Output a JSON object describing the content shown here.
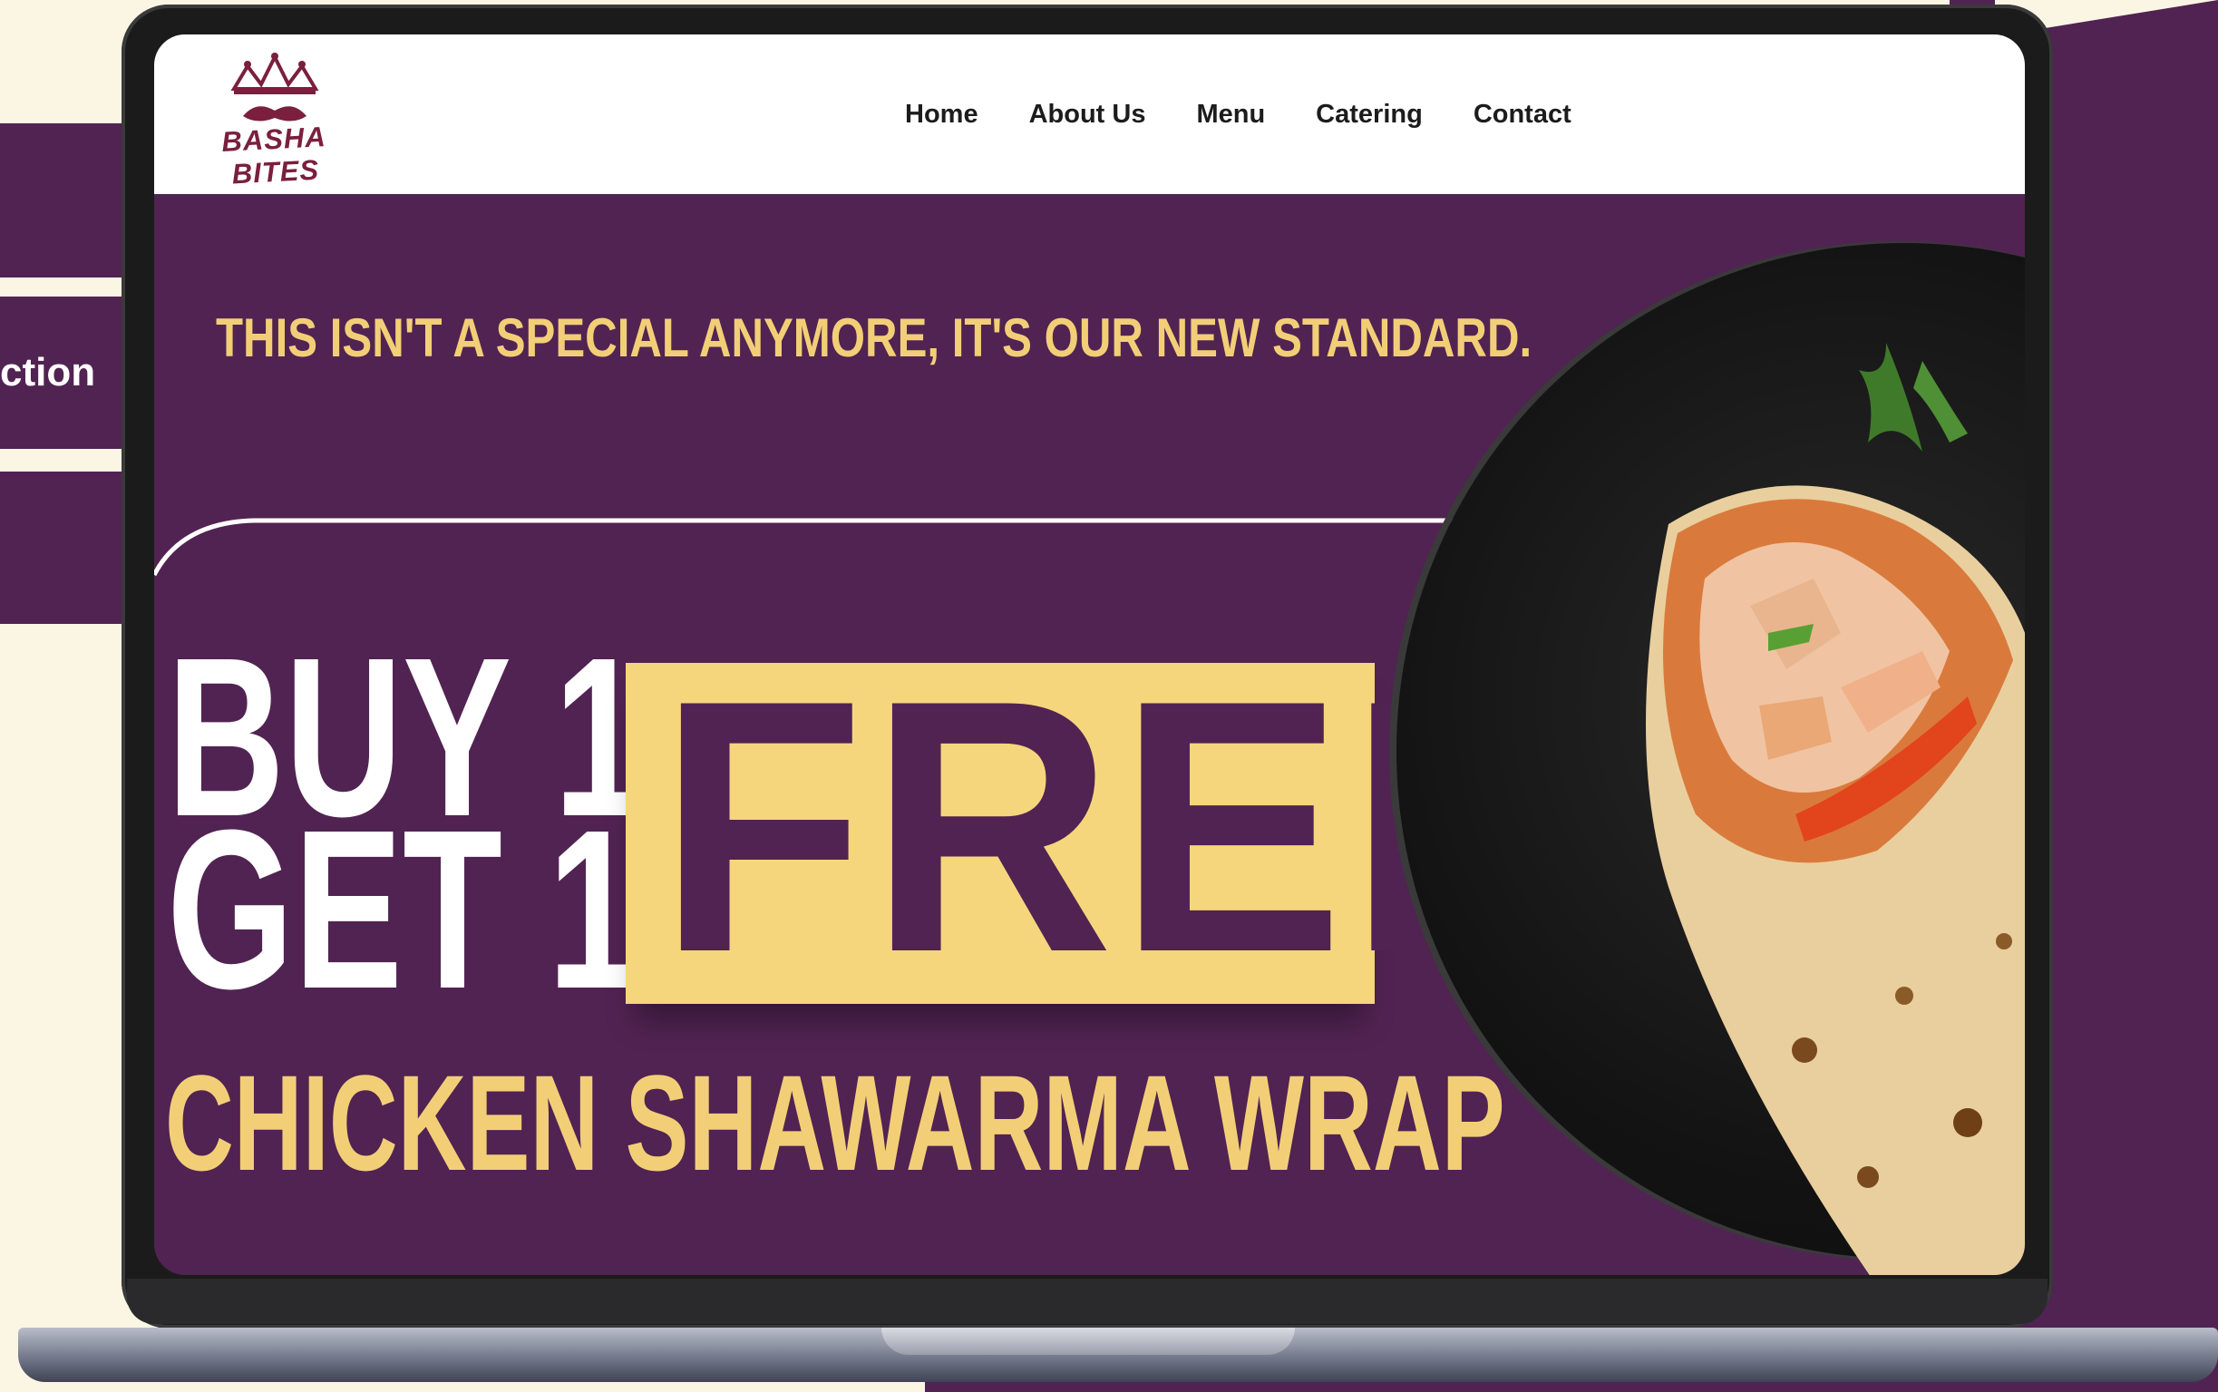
{
  "side_panel": {
    "label": "ction"
  },
  "brand": {
    "name": "BASHA BITES",
    "logo_icon": "crown-mustache-logo"
  },
  "nav": {
    "items": [
      {
        "label": "Home"
      },
      {
        "label": "About Us"
      },
      {
        "label": "Menu"
      },
      {
        "label": "Catering"
      },
      {
        "label": "Contact"
      }
    ]
  },
  "hero": {
    "tagline": "THIS ISN'T A SPECIAL ANYMORE, IT'S OUR NEW STANDARD.",
    "offer_line1": "BUY 1",
    "offer_line2": "GET 1",
    "highlight": "FREE",
    "product": "CHICKEN SHAWARMA WRAP",
    "image": "chicken-shawarma-wrap-on-plate"
  },
  "colors": {
    "brand_purple": "#512352",
    "accent_gold": "#f2cf77",
    "highlight_gold": "#f5d67c",
    "logo_maroon": "#7a1f3d",
    "page_cream": "#fbf6e4"
  }
}
